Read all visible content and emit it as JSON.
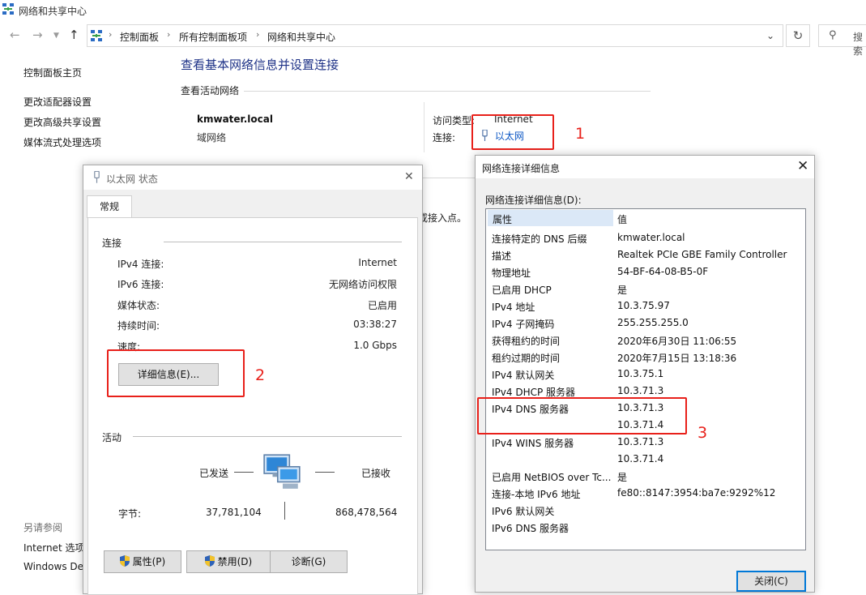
{
  "window": {
    "title": "网络和共享中心"
  },
  "address": {
    "crumbs": [
      "控制面板",
      "所有控制面板项",
      "网络和共享中心"
    ],
    "search_placeholder": "搜索"
  },
  "left_pane": {
    "links": [
      "控制面板主页",
      "更改适配器设置",
      "更改高级共享设置",
      "媒体流式处理选项"
    ],
    "see_also_title": "另请参阅",
    "see_also_links": [
      "Internet 选项",
      "Windows De"
    ]
  },
  "main": {
    "heading": "查看基本网络信息并设置连接",
    "active_section": "查看活动网络",
    "network_name": "kmwater.local",
    "network_type": "域网络",
    "access_type_label": "访问类型:",
    "access_type_value": "Internet",
    "connections_label": "连接:",
    "connection_link": "以太网",
    "partial_text": "或接入点。"
  },
  "annotations": [
    "1",
    "2",
    "3"
  ],
  "status_dialog": {
    "title": "以太网 状态",
    "tab": "常规",
    "connection_group": "连接",
    "rows": [
      {
        "k": "IPv4 连接:",
        "v": "Internet"
      },
      {
        "k": "IPv6 连接:",
        "v": "无网络访问权限"
      },
      {
        "k": "媒体状态:",
        "v": "已启用"
      },
      {
        "k": "持续时间:",
        "v": "03:38:27"
      },
      {
        "k": "速度:",
        "v": "1.0 Gbps"
      }
    ],
    "details_button": "详细信息(E)...",
    "activity_group": "活动",
    "sent_label": "已发送",
    "received_label": "已接收",
    "bytes_label": "字节:",
    "bytes_sent": "37,781,104",
    "bytes_received": "868,478,564",
    "buttons": [
      "属性(P)",
      "禁用(D)",
      "诊断(G)"
    ]
  },
  "detail_dialog": {
    "title": "网络连接详细信息",
    "caption": "网络连接详细信息(D):",
    "col_property": "属性",
    "col_value": "值",
    "rows": [
      {
        "k": "连接特定的 DNS 后缀",
        "v": "kmwater.local"
      },
      {
        "k": "描述",
        "v": "Realtek PCIe GBE Family Controller"
      },
      {
        "k": "物理地址",
        "v": "54-BF-64-08-B5-0F"
      },
      {
        "k": "已启用 DHCP",
        "v": "是"
      },
      {
        "k": "IPv4 地址",
        "v": "10.3.75.97"
      },
      {
        "k": "IPv4 子网掩码",
        "v": "255.255.255.0"
      },
      {
        "k": "获得租约的时间",
        "v": "2020年6月30日 11:06:55"
      },
      {
        "k": "租约过期的时间",
        "v": "2020年7月15日 13:18:36"
      },
      {
        "k": "IPv4 默认网关",
        "v": "10.3.75.1"
      },
      {
        "k": "IPv4 DHCP 服务器",
        "v": "10.3.71.3"
      },
      {
        "k": "IPv4 DNS 服务器",
        "v": "10.3.71.3"
      },
      {
        "k": "",
        "v": "10.3.71.4"
      },
      {
        "k": "IPv4 WINS 服务器",
        "v": "10.3.71.3"
      },
      {
        "k": "",
        "v": "10.3.71.4"
      },
      {
        "k": "已启用 NetBIOS over Tc...",
        "v": "是"
      },
      {
        "k": "连接-本地 IPv6 地址",
        "v": "fe80::8147:3954:ba7e:9292%12"
      },
      {
        "k": "IPv6 默认网关",
        "v": ""
      },
      {
        "k": "IPv6 DNS 服务器",
        "v": ""
      }
    ],
    "close_button": "关闭(C)"
  },
  "colors": {
    "link": "#0b56c4",
    "heading": "#1e3287",
    "annotation": "#e8201a",
    "focus": "#0078d7"
  }
}
